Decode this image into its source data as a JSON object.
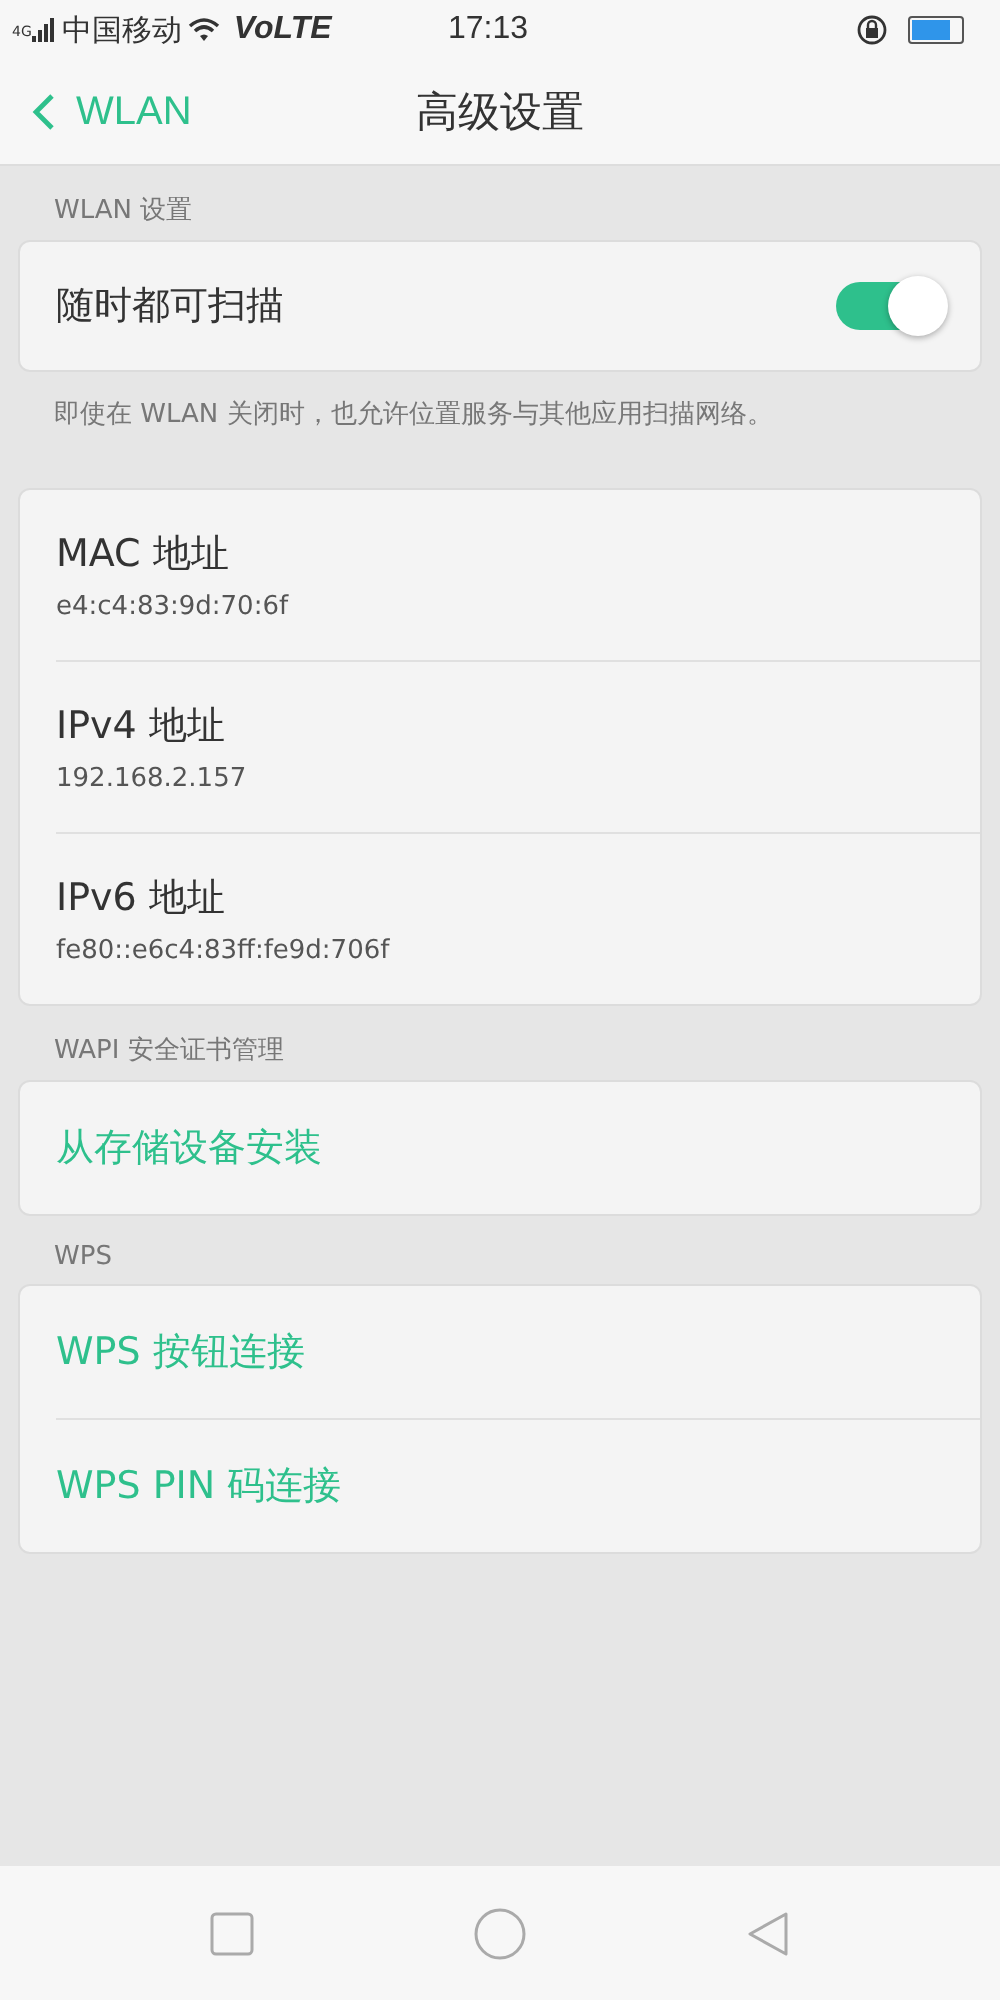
{
  "status_bar": {
    "network": "4G",
    "carrier": "中国移动",
    "volte": "VoLTE",
    "time": "17:13"
  },
  "header": {
    "back_label": "WLAN",
    "title": "高级设置"
  },
  "sections": [
    {
      "label": "WLAN 设置",
      "items": [
        {
          "kind": "toggle",
          "title": "随时都可扫描",
          "on": true
        }
      ],
      "note": "即使在 WLAN 关闭时，也允许位置服务与其他应用扫描网络。"
    },
    {
      "items": [
        {
          "kind": "info",
          "title": "MAC 地址",
          "value": "e4:c4:83:9d:70:6f"
        },
        {
          "kind": "info",
          "title": "IPv4 地址",
          "value": "192.168.2.157"
        },
        {
          "kind": "info",
          "title": "IPv6 地址",
          "value": "fe80::e6c4:83ff:fe9d:706f"
        }
      ]
    },
    {
      "label": "WAPI 安全证书管理",
      "items": [
        {
          "kind": "link",
          "title": "从存储设备安装"
        }
      ]
    },
    {
      "label": "WPS",
      "items": [
        {
          "kind": "link",
          "title": "WPS 按钮连接"
        },
        {
          "kind": "link",
          "title": "WPS PIN 码连接"
        }
      ]
    }
  ]
}
